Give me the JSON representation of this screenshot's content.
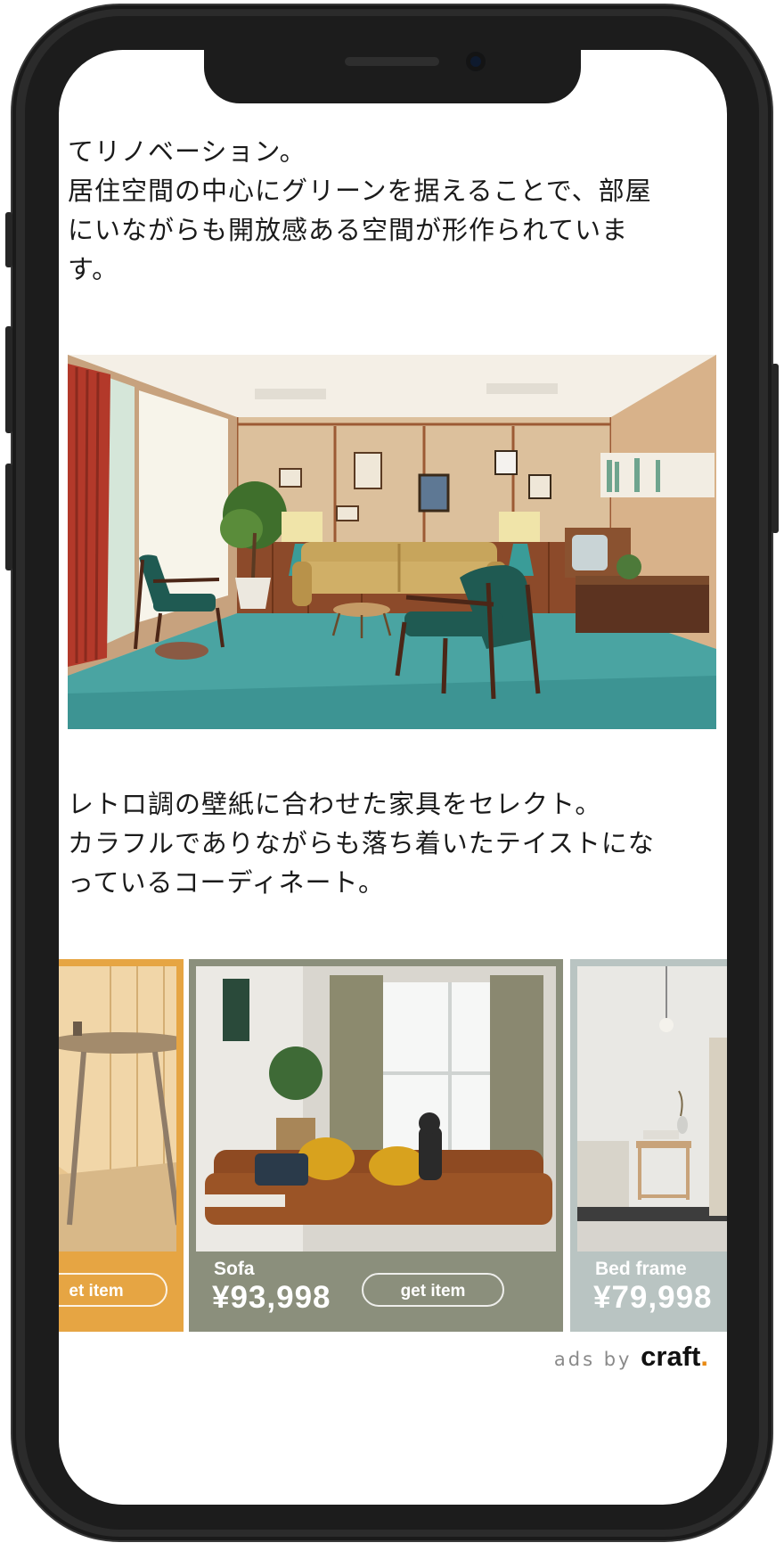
{
  "article": {
    "paragraph1_lines": [
      "てリノベーション。",
      "居住空間の中心にグリーンを据えることで、部屋",
      "にいながらも開放感ある空間が形作られていま",
      "す。"
    ],
    "paragraph2_lines": [
      "レトロ調の壁紙に合わせた家具をセレクト。",
      "カラフルでありながらも落ち着いたテイストにな",
      "っているコーディネート。"
    ]
  },
  "ads": {
    "cards": [
      {
        "name": "",
        "price": "",
        "button": "et item",
        "accent": "#e6a543"
      },
      {
        "name": "Sofa",
        "price": "¥93,998",
        "button": "get item",
        "accent": "#8b8f7c"
      },
      {
        "name": "Bed frame",
        "price": "¥79,998",
        "button": "",
        "accent": "#b9c4c2"
      }
    ],
    "ads_by_label": "ads by",
    "brand": "craft",
    "brand_dot": "."
  }
}
